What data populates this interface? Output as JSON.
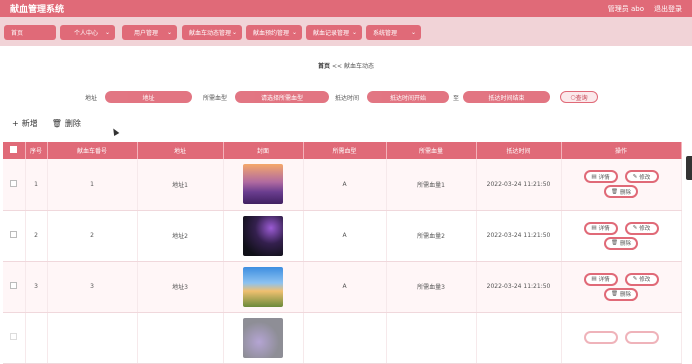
{
  "header": {
    "title": "献血管理系统",
    "user": "管理员 abo",
    "logout": "退出登录"
  },
  "menu": [
    {
      "label": "首页"
    },
    {
      "label": "个人中心"
    },
    {
      "label": "用户管理"
    },
    {
      "label": "献血车动态管理"
    },
    {
      "label": "献血预约管理"
    },
    {
      "label": "献血记录管理"
    },
    {
      "label": "系统管理"
    }
  ],
  "breadcrumb": {
    "home": "首页",
    "sep": "<<",
    "current": "献血车动态"
  },
  "filters": {
    "address_label": "地址",
    "address_placeholder": "地址",
    "hospital_label": "所需血型",
    "hospital_placeholder": "请选择所需血型",
    "time_label": "抵达时间",
    "start_placeholder": "抵达时间开始",
    "to_label": "至",
    "end_placeholder": "抵达时间结束",
    "query": "查询"
  },
  "toolbar": {
    "add": "新增",
    "delete": "删除"
  },
  "table": {
    "headers": [
      "序号",
      "献血车番号",
      "地址",
      "封面",
      "所需血型",
      "所需血量",
      "抵达时间",
      "操作"
    ],
    "rows": [
      {
        "index": "1",
        "car": "1",
        "address": "地址1",
        "type": "A",
        "amount": "所需血量1",
        "time": "2022-03-24 11:21:50"
      },
      {
        "index": "2",
        "car": "2",
        "address": "地址2",
        "type": "A",
        "amount": "所需血量2",
        "time": "2022-03-24 11:21:50"
      },
      {
        "index": "3",
        "car": "3",
        "address": "地址3",
        "type": "A",
        "amount": "所需血量3",
        "time": "2022-03-24 11:21:50"
      }
    ],
    "ops": {
      "detail": "详情",
      "edit": "修改",
      "delete": "删除"
    }
  }
}
